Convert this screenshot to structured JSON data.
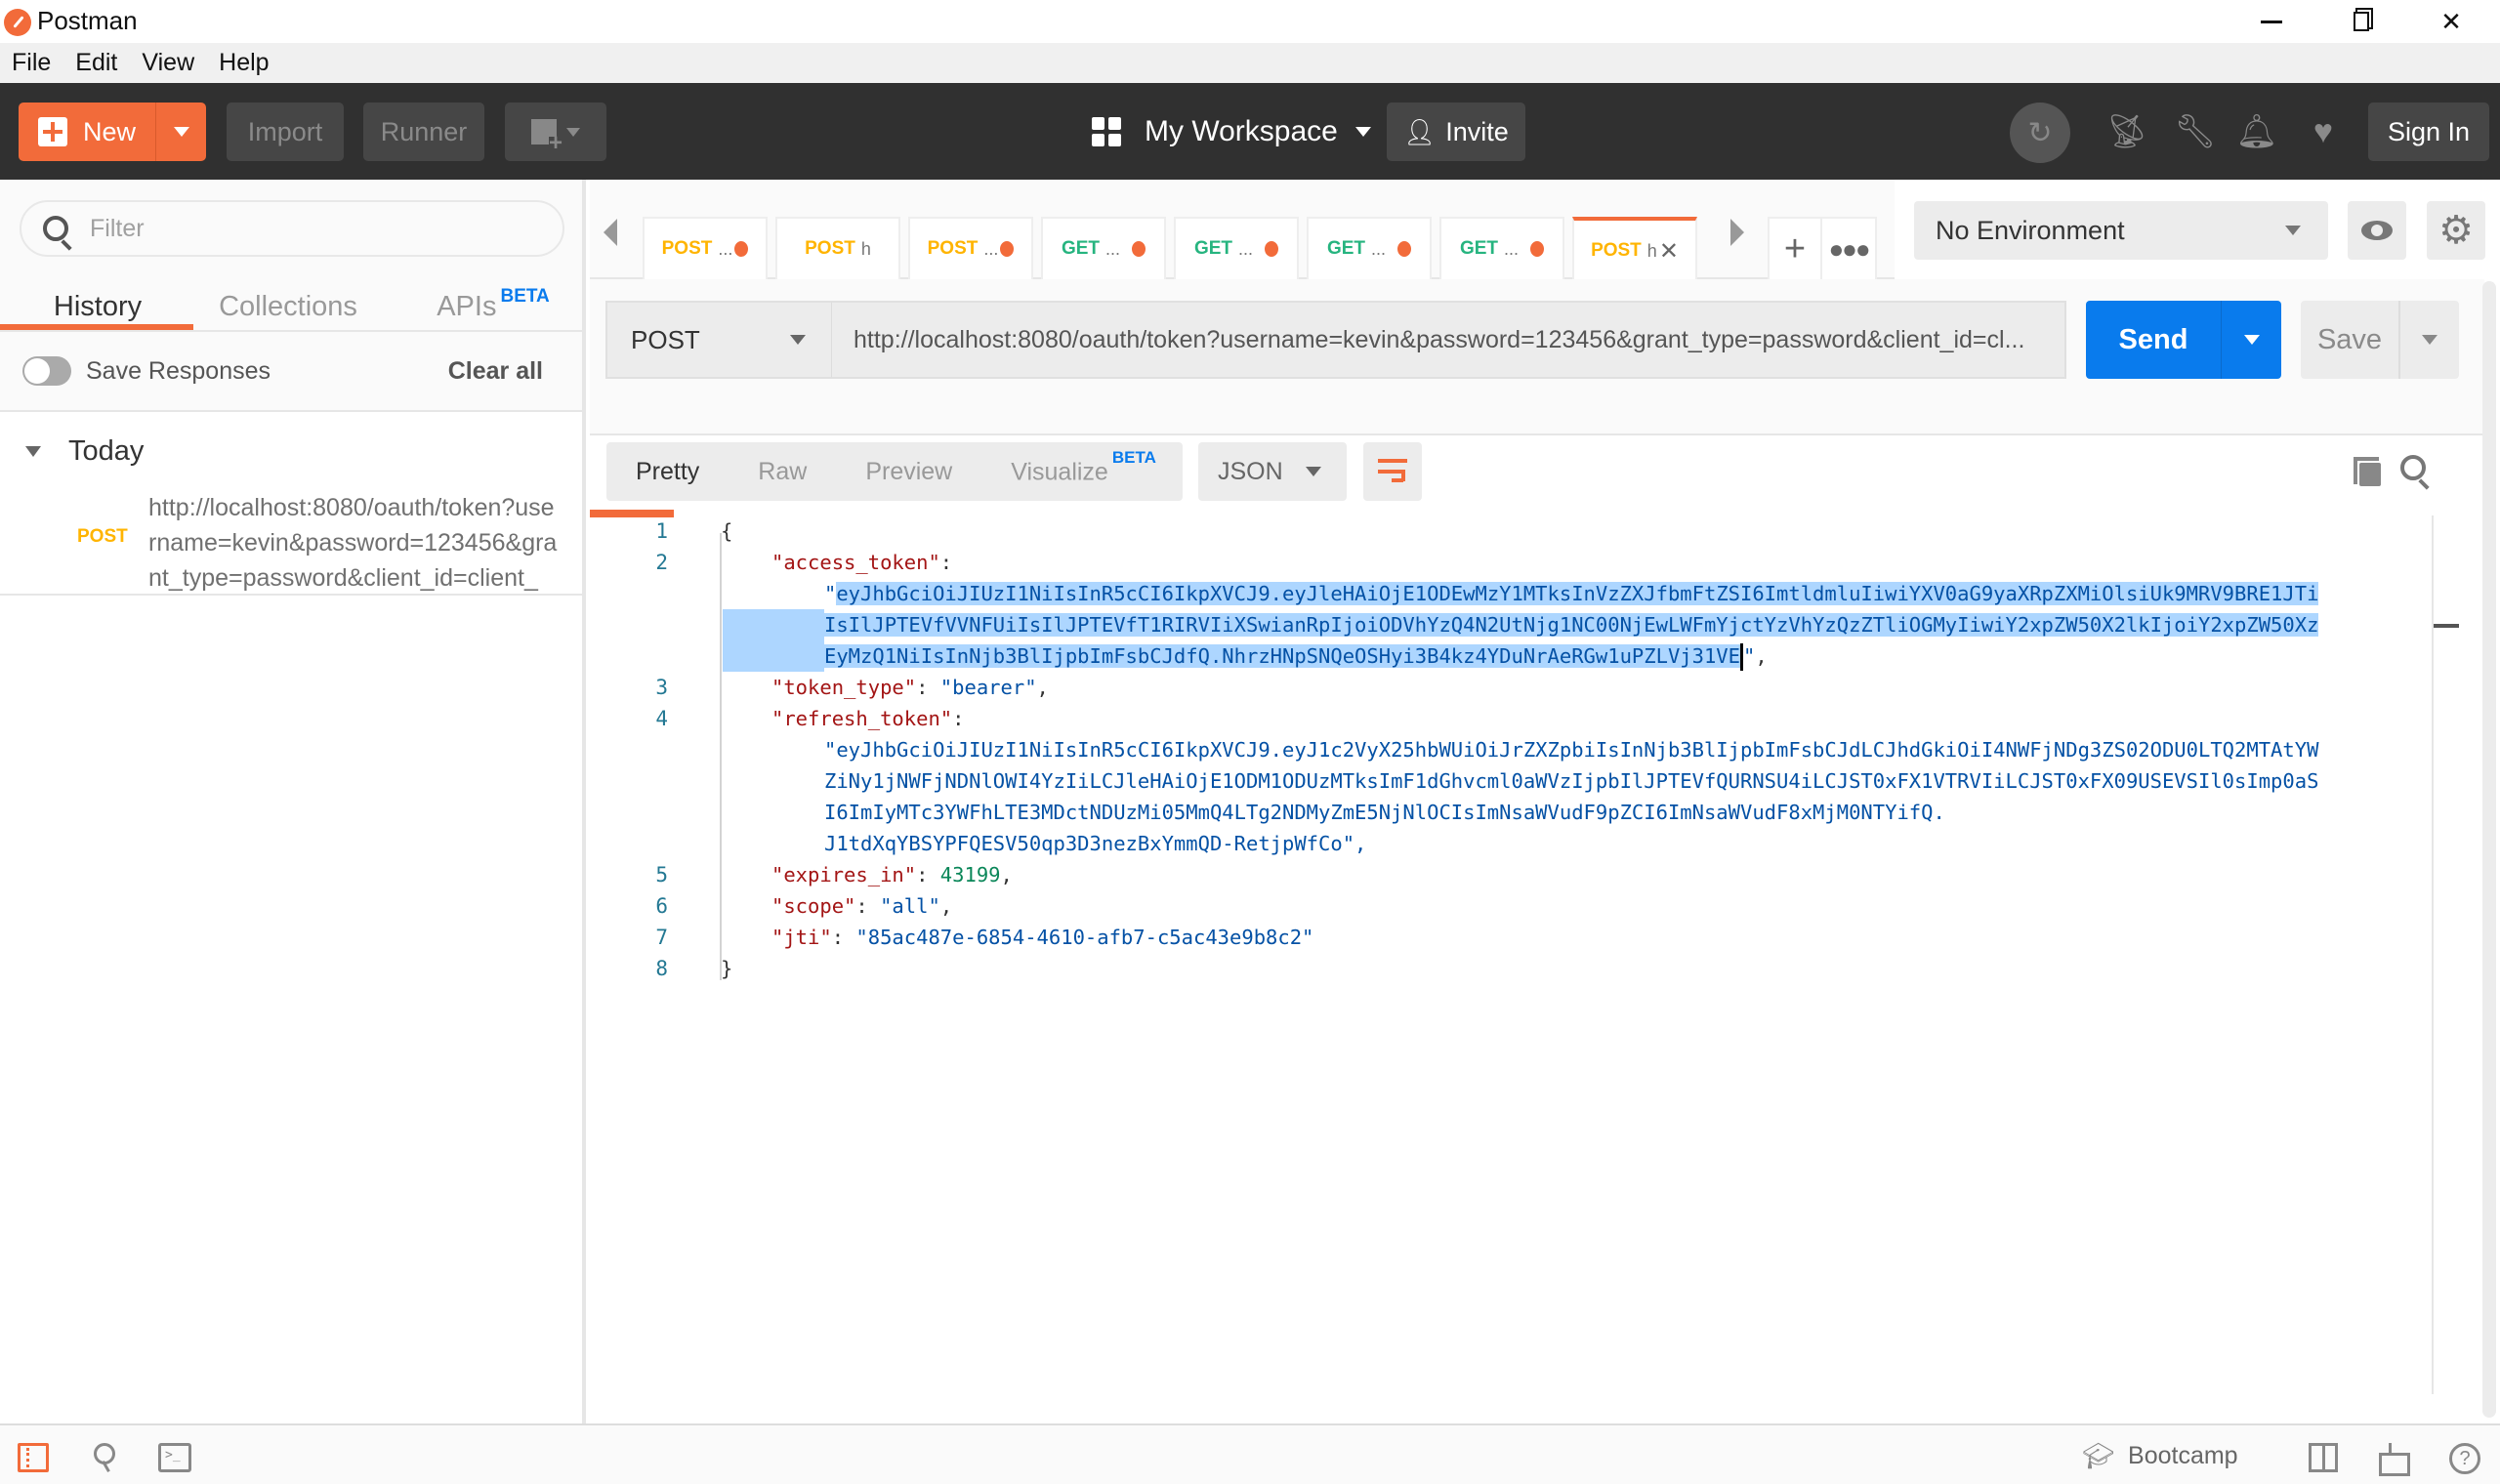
{
  "window": {
    "title": "Postman",
    "controls": {
      "minimize": "–",
      "restore": "❐",
      "close": "✕"
    }
  },
  "menu": [
    "File",
    "Edit",
    "View",
    "Help"
  ],
  "toolbar": {
    "new_label": "New",
    "import_label": "Import",
    "runner_label": "Runner",
    "workspace_label": "My Workspace",
    "invite_label": "Invite",
    "signin_label": "Sign In",
    "icons": [
      "sync-off-icon",
      "satellite-icon",
      "wrench-icon",
      "bell-icon",
      "heart-icon"
    ]
  },
  "sidebar": {
    "filter_placeholder": "Filter",
    "tabs": [
      {
        "label": "History",
        "active": true
      },
      {
        "label": "Collections",
        "active": false
      },
      {
        "label": "APIs",
        "badge": "BETA",
        "active": false
      }
    ],
    "save_responses_label": "Save Responses",
    "save_responses_on": false,
    "clear_all_label": "Clear all",
    "group_label": "Today",
    "history": [
      {
        "method": "POST",
        "url": "http://localhost:8080/oauth/token?username=kevin&password=123456&grant_type=password&client_id=client_"
      }
    ]
  },
  "tabs": [
    {
      "method": "POST",
      "title": "...",
      "unsaved": true
    },
    {
      "method": "POST",
      "title": "h",
      "unsaved": false
    },
    {
      "method": "POST",
      "title": "...",
      "unsaved": true
    },
    {
      "method": "GET",
      "title": "...",
      "unsaved": true
    },
    {
      "method": "GET",
      "title": "...",
      "unsaved": true
    },
    {
      "method": "GET",
      "title": "...",
      "unsaved": true
    },
    {
      "method": "GET",
      "title": "...",
      "unsaved": true
    },
    {
      "method": "POST",
      "title": "h",
      "unsaved": false,
      "active": true
    }
  ],
  "environment": {
    "selected": "No Environment"
  },
  "request": {
    "method": "POST",
    "url": "http://localhost:8080/oauth/token?username=kevin&password=123456&grant_type=password&client_id=cl...",
    "send_label": "Send",
    "save_label": "Save"
  },
  "response": {
    "view_tabs": [
      {
        "label": "Pretty",
        "active": true
      },
      {
        "label": "Raw",
        "active": false
      },
      {
        "label": "Preview",
        "active": false
      },
      {
        "label": "Visualize",
        "badge": "BETA",
        "active": false
      }
    ],
    "format": "JSON",
    "body": {
      "open_brace": "{",
      "close_brace": "}",
      "access_token_key": "\"access_token\"",
      "access_token_lines": [
        "eyJhbGciOiJIUzI1NiIsInR5cCI6IkpXVCJ9.eyJleHAiOjE1ODEwMzY1MTksInVzZXJfbmFtZSI6ImtldmluIiwiYXV0aG9yaXRpZXMiOlsiUk9MRV9BRE1JTi",
        "IsIlJPTEVfVVNFUiIsIlJPTEVfT1RIRVIiXSwianRpIjoiODVhYzQ4N2UtNjg1NC00NjEwLWFmYjctYzVhYzQzZTliOGMyIiwiY2xpZW50X2lkIjoiY2xpZW50Xz",
        "EyMzQ1NiIsInNjb3BlIjpbImFsbCJdfQ.NhrzHNpSNQeOSHyi3B4kz4YDuNrAeRGw1uPZLVj31VE"
      ],
      "token_type_key": "\"token_type\"",
      "token_type": "\"bearer\"",
      "refresh_token_key": "\"refresh_token\"",
      "refresh_token_lines": [
        "\"eyJhbGciOiJIUzI1NiIsInR5cCI6IkpXVCJ9.eyJ1c2VyX25hbWUiOiJrZXZpbiIsInNjb3BlIjpbImFsbCJdLCJhdGkiOiI4NWFjNDg3ZS02ODU0LTQ2MTAtYW",
        "ZiNy1jNWFjNDNlOWI4YzIiLCJleHAiOjE1ODM1ODUzMTksImF1dGhvcml0aWVzIjpbIlJPTEVfQURNSU4iLCJST0xFX1VTRVIiLCJST0xFX09USEVSIl0sImp0aS",
        "I6ImIyMTc3YWFhLTE3MDctNDUzMi05MmQ4LTg2NDMyZmE5NjNlOCIsImNsaWVudF9pZCI6ImNsaWVudF8xMjM0NTYifQ.",
        "J1tdXqYBSYPFQESV50qp3D3nezBxYmmQD-RetjpWfCo\","
      ],
      "expires_in_key": "\"expires_in\"",
      "expires_in": "43199",
      "scope_key": "\"scope\"",
      "scope": "\"all\"",
      "jti_key": "\"jti\"",
      "jti": "\"85ac487e-6854-4610-afb7-c5ac43e9b8c2\"",
      "line_numbers": [
        "1",
        "2",
        "3",
        "4",
        "5",
        "6",
        "7",
        "8"
      ]
    }
  },
  "statusbar": {
    "bootcamp_label": "Bootcamp",
    "help_label": "?"
  },
  "colors": {
    "brand_orange": "#f26b3a",
    "send_blue": "#097bed",
    "post_method": "#ffb400",
    "get_method": "#26b47f",
    "json_key": "#a31515",
    "json_string": "#0451a5",
    "json_number": "#098658",
    "selection": "#add6ff"
  }
}
